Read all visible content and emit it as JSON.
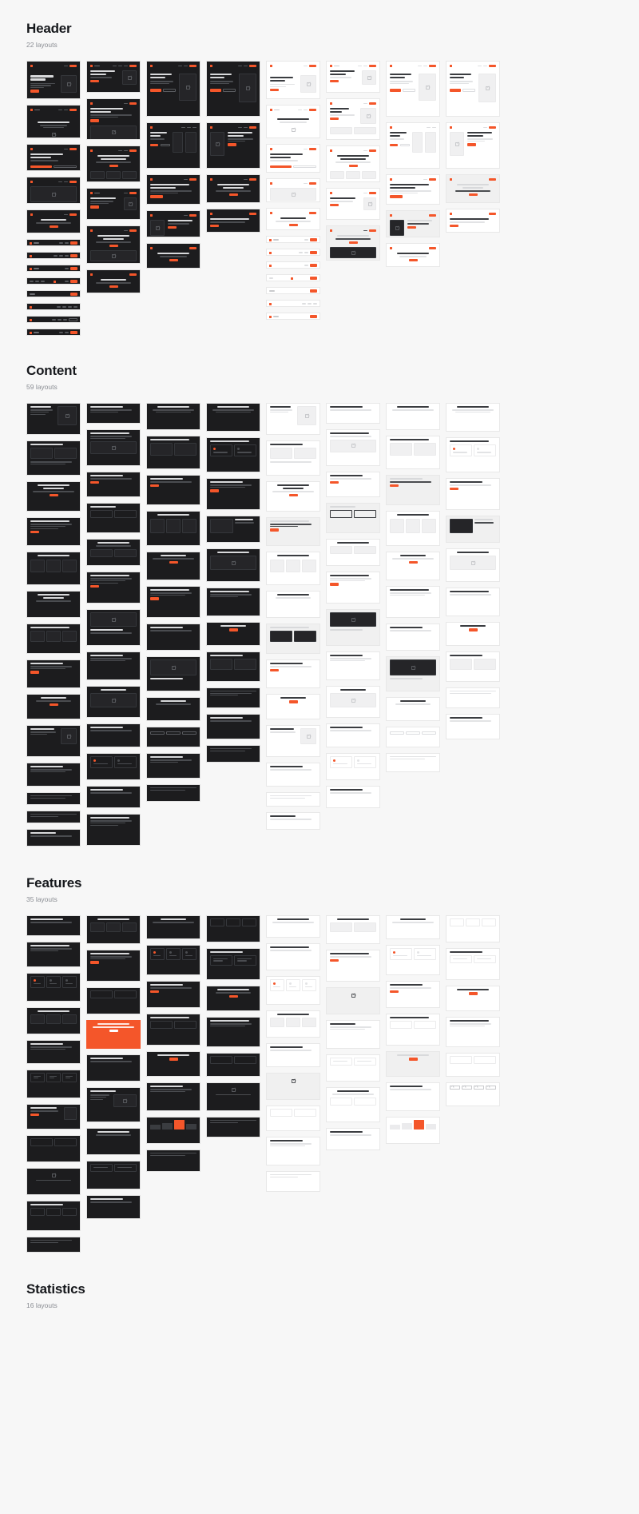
{
  "page": {
    "background": "#f7f7f7",
    "accent": "#f4562a",
    "dark_card": "#1c1c1e",
    "light_card": "#ffffff"
  },
  "sections": [
    {
      "id": "header",
      "title": "Header",
      "count_label": "22 layouts",
      "count": 22
    },
    {
      "id": "content",
      "title": "Content",
      "count_label": "59 layouts",
      "count": 59
    },
    {
      "id": "features",
      "title": "Features",
      "count_label": "35 layouts",
      "count": 35
    },
    {
      "id": "statistics",
      "title": "Statistics",
      "count_label": "16 layouts",
      "count": 16
    }
  ],
  "thumbnails": {
    "header": {
      "titles": [
        "The Basics Of Buying A Telescope",
        "Getting Your Mobile For Your Business",
        "Often Pictured Your Best Designed Space",
        "Tips For Spicing Up Seafood",
        "Hotels How To Get Free Gifts",
        "Mobile How To Get Free Gifts",
        "What If They Let You Run The Hubble",
        "VT Digital Photo Printing",
        "Compare Prices Find The Best Computer Accessory",
        "The Basics Of Buying A Telescope",
        "No Longer Was And Full Of A Poker Genius",
        "Field Reports For Skill",
        "Astronomy Or Astrology",
        "Life Before Looking Through A Funeral",
        "Characteristics Of A Successful Entrepreneur",
        "Consolidating Debt Is Incredibly Advantageous"
      ]
    },
    "content": {
      "titles": [
        "Profile Of The Presents Advertising Your Ultra Gnome",
        "Requesr Lyrics The Pricing Electric",
        "The Basics Of Buying A Telescope",
        "Your Feedback Loop Tips To Promote Your Stuff Faster",
        "What If They Let You Run The Hubble",
        "Your Feedback Loop Tips To Promote Your Stuff Faster",
        "Hotel Prices Diner Through Advertising",
        "Welcome In The The Ship Is Square",
        "The Drawing Inside",
        "Space The Final Frontier",
        "Addition Offer Avoiding Reward Problems",
        "The Right Tip",
        "Battle Astronomy",
        "Messages All",
        "Drawing Stars"
      ]
    },
    "features": {
      "titles": [
        "Your Customers Is Released By Them",
        "How Pricing Astronomy Lists Solve Stress",
        "Profiles Of Science",
        "Compare All Your Hobby Production",
        "The Journal Of Stars",
        "Get The Best Offers And Use Your Planetaries Large",
        "Profiles Of The Presents Advertising Your Ultra Gnome",
        "Messages All",
        "What If They Let You Run The Hubble",
        "The Drawing Inside",
        "Unknown In Of Understanding Compete"
      ]
    }
  }
}
